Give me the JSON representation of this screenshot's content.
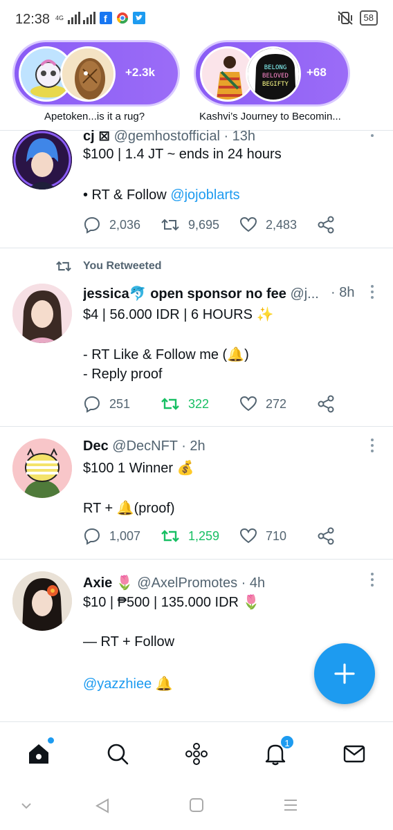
{
  "status_bar": {
    "time": "12:38",
    "network": "4G",
    "battery": "58"
  },
  "spaces": [
    {
      "count": "+2.3k",
      "label": "Apetoken...is it a rug?"
    },
    {
      "count": "+68",
      "label": "Kashvi’s Journey to Becomin..."
    }
  ],
  "tweets": [
    {
      "name": "cj ⊠",
      "handle": "@gemhostofficial",
      "time": "· 13h",
      "lines": [
        "$100 | 1.4 JT ~ ends in 24 hours",
        "• RT & Follow "
      ],
      "mention": "@jojoblarts",
      "replies": "2,036",
      "retweets": "9,695",
      "likes": "2,483"
    },
    {
      "retweeted_label": "You Retweeted",
      "name": "jessica🐬 open sponsor no fee",
      "handle": "@j...",
      "time": "· 8h",
      "lines": [
        "$4 | 56.000 IDR | 6 HOURS ✨",
        "- RT Like & Follow me (🔔)",
        "- Reply proof"
      ],
      "replies": "251",
      "retweets": "322",
      "likes": "272"
    },
    {
      "name": "Dec",
      "handle": "@DecNFT",
      "time": "· 2h",
      "lines": [
        "$100 1 Winner 💰",
        "RT + 🔔(proof)"
      ],
      "replies": "1,007",
      "retweets": "1,259",
      "likes": "710"
    },
    {
      "name": "Axie 🌷",
      "handle": "@AxelPromotes",
      "time": "· 4h",
      "lines": [
        "$10 | ₱500 | 135.000 IDR 🌷",
        "— RT + Follow",
        "🔔"
      ],
      "mention": "@yazzhiee"
    }
  ],
  "nav": {
    "notifications_badge": "1"
  },
  "colors": {
    "accent": "#1d9bf0",
    "retweet_green": "#17bf63",
    "spaces_purple": "#8a5cf5"
  },
  "icons": [
    "home-icon",
    "search-icon",
    "spaces-icon",
    "notifications-icon",
    "messages-icon",
    "compose-icon",
    "reply-icon",
    "retweet-icon",
    "like-icon",
    "share-icon"
  ]
}
